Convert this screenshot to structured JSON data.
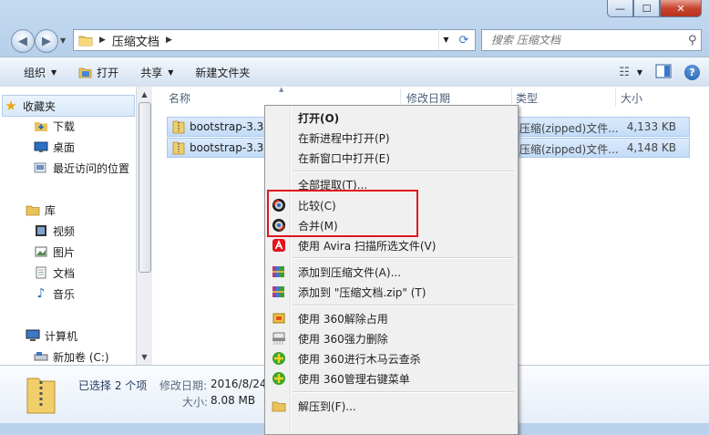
{
  "window": {
    "address_crumb": "压缩文档",
    "search_placeholder": "搜索 压缩文档",
    "min_glyph": "—",
    "max_glyph": "☐",
    "close_glyph": "✕"
  },
  "toolbar": {
    "organize": "组织",
    "open": "打开",
    "share": "共享",
    "new_folder": "新建文件夹"
  },
  "nav": {
    "favorites": "收藏夹",
    "downloads": "下载",
    "desktop": "桌面",
    "recent": "最近访问的位置",
    "library": "库",
    "videos": "视频",
    "pictures": "图片",
    "documents": "文档",
    "music": "音乐",
    "computer": "计算机",
    "new_volume": "新加卷 (C:)"
  },
  "columns": {
    "name": "名称",
    "modified": "修改日期",
    "type": "类型",
    "size": "大小"
  },
  "files": [
    {
      "name": "bootstrap-3.3.7",
      "type": "压缩(zipped)文件...",
      "size": "4,133 KB"
    },
    {
      "name": "bootstrap-3.3.7",
      "type": "压缩(zipped)文件...",
      "size": "4,148 KB"
    }
  ],
  "details": {
    "selected": "已选择 2 个项",
    "modified_label": "修改日期:",
    "modified_value": "2016/8/24",
    "size_label": "大小:",
    "size_value": "8.08 MB"
  },
  "menu": {
    "open": "打开(O)",
    "open_new_process": "在新进程中打开(P)",
    "open_new_window": "在新窗口中打开(E)",
    "extract_all": "全部提取(T)...",
    "compare": "比较(C)",
    "merge": "合并(M)",
    "avira_scan": "使用 Avira 扫描所选文件(V)",
    "add_to_archive": "添加到压缩文件(A)...",
    "add_to_zip": "添加到 \"压缩文档.zip\" (T)",
    "unlock_360": "使用 360解除占用",
    "force_delete_360": "使用 360强力删除",
    "trojan_cloud_360": "使用 360进行木马云查杀",
    "manage_menu_360": "使用 360管理右键菜单",
    "extract_to": "解压到(F)..."
  },
  "colors": {
    "highlight_box": "#e0141e",
    "selection": "#c3dcf7"
  }
}
